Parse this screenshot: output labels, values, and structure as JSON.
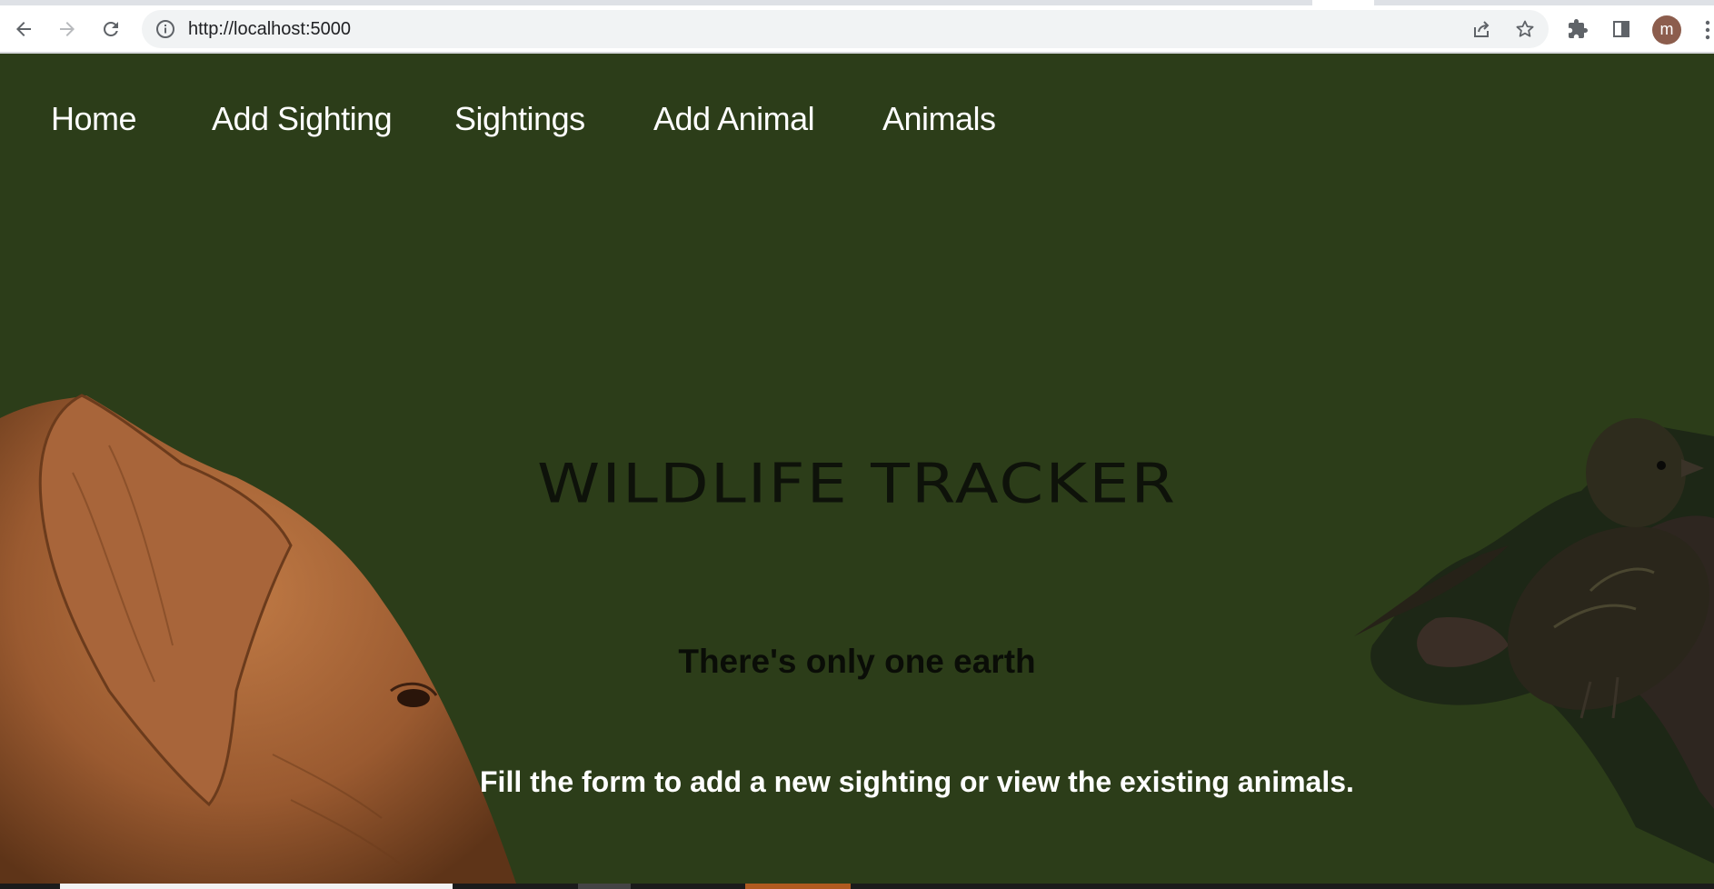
{
  "browser": {
    "url": "http://localhost:5000",
    "profile_initial": "m",
    "icons": {
      "back": "arrow-left-icon",
      "forward": "arrow-right-icon",
      "reload": "reload-icon",
      "site_info": "info-icon",
      "share": "share-icon",
      "bookmark": "star-icon",
      "extensions": "puzzle-icon",
      "side_panel": "side-panel-icon",
      "menu": "kebab-menu-icon"
    }
  },
  "nav": {
    "items": [
      {
        "label": "Home"
      },
      {
        "label": "Add Sighting"
      },
      {
        "label": "Sightings"
      },
      {
        "label": "Add Animal"
      },
      {
        "label": "Animals"
      }
    ]
  },
  "hero": {
    "title": "WILDLIFE TRACKER",
    "tagline": "There's only one earth",
    "subtext": "Fill the form to add a new sighting or view the existing animals."
  },
  "colors": {
    "page_background": "#2c3d19",
    "nav_text": "#ffffff",
    "title_text": "#0e120a",
    "subtext": "#ffffff"
  }
}
